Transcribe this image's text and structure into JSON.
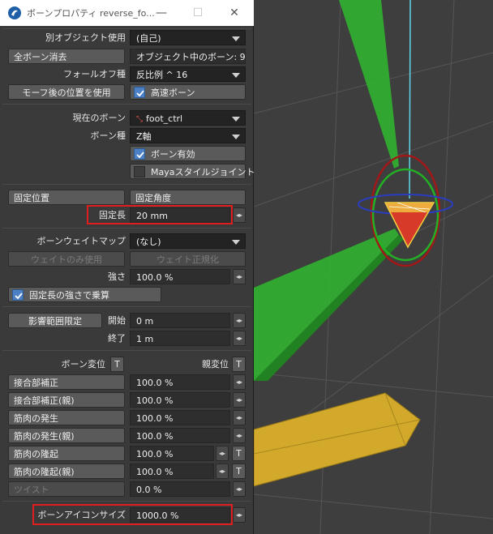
{
  "window": {
    "title": "ボーンプロパティ reverse_fo...",
    "app_icon": "lightwave-icon",
    "controls": {
      "minimize": "—",
      "maximize": "☐",
      "close": "✕"
    }
  },
  "section_object": {
    "other_object_label": "別オブジェクト使用",
    "other_object_value": "(自己)",
    "clear_all_button": "全ボーン消去",
    "object_bones_text": "オブジェクト中のボーン: 9",
    "falloff_label": "フォールオフ種",
    "falloff_value": "反比例 ^ 16",
    "after_morph_button": "モーフ後の位置を使用",
    "fast_bones_label": "高速ボーン",
    "fast_bones_checked": true
  },
  "section_bone": {
    "current_bone_label": "現在のボーン",
    "current_bone_value": "foot_ctrl",
    "bone_type_label": "ボーン種",
    "bone_type_value": "Z軸",
    "bone_active_label": "ボーン有効",
    "bone_active_checked": true,
    "maya_joint_label": "Mayaスタイルジョイント",
    "maya_joint_checked": false
  },
  "section_rest": {
    "rest_position_button": "固定位置",
    "rest_rotation_button": "固定角度",
    "rest_length_label": "固定長",
    "rest_length_value": "20 mm"
  },
  "section_weight": {
    "weight_map_label": "ボーンウェイトマップ",
    "weight_map_value": "(なし)",
    "use_weight_only_button": "ウェイトのみ使用",
    "normalize_weight_button": "ウェイト正規化",
    "strength_label": "強さ",
    "strength_value": "100.0 %",
    "multiply_rest_label": "固定長の強さで乗算",
    "multiply_rest_checked": true
  },
  "section_limit": {
    "limited_range_button": "影響範囲限定",
    "start_label": "開始",
    "start_value": "0 m",
    "end_label": "終了",
    "end_value": "1 m"
  },
  "section_deform": {
    "bone_deform_label": "ボーン変位",
    "parent_deform_label": "親変位",
    "t_label": "T",
    "rows": [
      {
        "label": "接合部補正",
        "value": "100.0 %",
        "dim": false,
        "t": false
      },
      {
        "label": "接合部補正(親)",
        "value": "100.0 %",
        "dim": false,
        "t": false
      },
      {
        "label": "筋肉の発生",
        "value": "100.0 %",
        "dim": false,
        "t": false
      },
      {
        "label": "筋肉の発生(親)",
        "value": "100.0 %",
        "dim": false,
        "t": false
      },
      {
        "label": "筋肉の隆起",
        "value": "100.0 %",
        "dim": false,
        "t": true
      },
      {
        "label": "筋肉の隆起(親)",
        "value": "100.0 %",
        "dim": false,
        "t": true
      },
      {
        "label": "ツイスト",
        "value": "0.0 %",
        "dim": true,
        "t": false
      }
    ],
    "spinner_glyph": "◂▸"
  },
  "section_icon": {
    "icon_size_label": "ボーンアイコンサイズ",
    "icon_size_value": "1000.0 %"
  },
  "colors": {
    "viewport_bg": "#3e3e3e",
    "grid": "#5a5a5a",
    "bone_green": "#2fb82f",
    "bone_yellow": "#e3b52a",
    "highlight_red": "#e01e1e",
    "check_blue": "#4b80c4"
  }
}
